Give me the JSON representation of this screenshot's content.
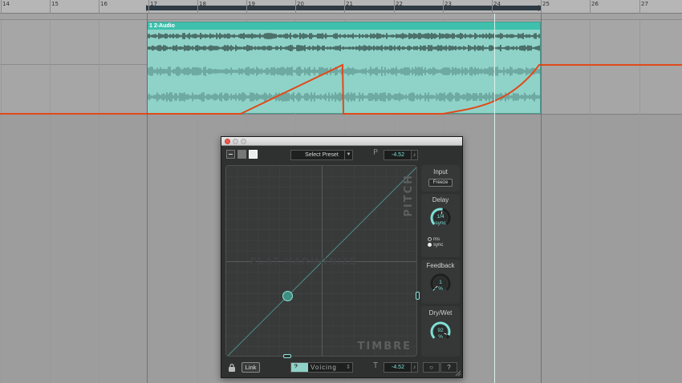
{
  "ruler": {
    "bars": [
      {
        "label": "14"
      },
      {
        "label": "15"
      },
      {
        "label": "16"
      },
      {
        "label": "17"
      },
      {
        "label": "18"
      },
      {
        "label": "19"
      },
      {
        "label": "20"
      },
      {
        "label": "21"
      },
      {
        "label": "22"
      },
      {
        "label": "23"
      },
      {
        "label": "24"
      },
      {
        "label": "25"
      },
      {
        "label": "26"
      },
      {
        "label": "27"
      }
    ]
  },
  "clip": {
    "name": "1 2-Audio",
    "color": "#8fd3c8",
    "header_color": "#3ec0ad"
  },
  "automation": {
    "color": "#e04a1c"
  },
  "plugin": {
    "preset": {
      "label": "Select Preset",
      "arrow": "▼"
    },
    "pitch": {
      "letter": "P",
      "value": "-4.52",
      "note_icon": "♪"
    },
    "timbre": {
      "letter": "T",
      "value": "-4.52",
      "note_icon": "♪"
    },
    "pad": {
      "y_axis_label": "PITCH",
      "x_axis_label": "TIMBRE",
      "ghost_label": "FLAT HARMONIZE"
    },
    "input": {
      "title": "Input",
      "freeze_label": "Freeze"
    },
    "delay": {
      "title": "Delay",
      "value": "1/4",
      "unit": "sync",
      "level": 0.55,
      "mode_options": [
        {
          "label": "ms",
          "selected": false
        },
        {
          "label": "sync",
          "selected": true
        }
      ]
    },
    "feedback": {
      "title": "Feedback",
      "value": "1",
      "unit": "%",
      "level": 0.01
    },
    "drywet": {
      "title": "Dry/Wet",
      "value": "92",
      "unit": "%",
      "level": 0.92
    },
    "bottom": {
      "link_label": "Link",
      "voicing_label": "Voicing",
      "voicing_clef": "𝄢",
      "voicing_arrow": "⇕",
      "power_icon": "○",
      "help_label": "?"
    },
    "accent_color": "#7fe0d4"
  }
}
